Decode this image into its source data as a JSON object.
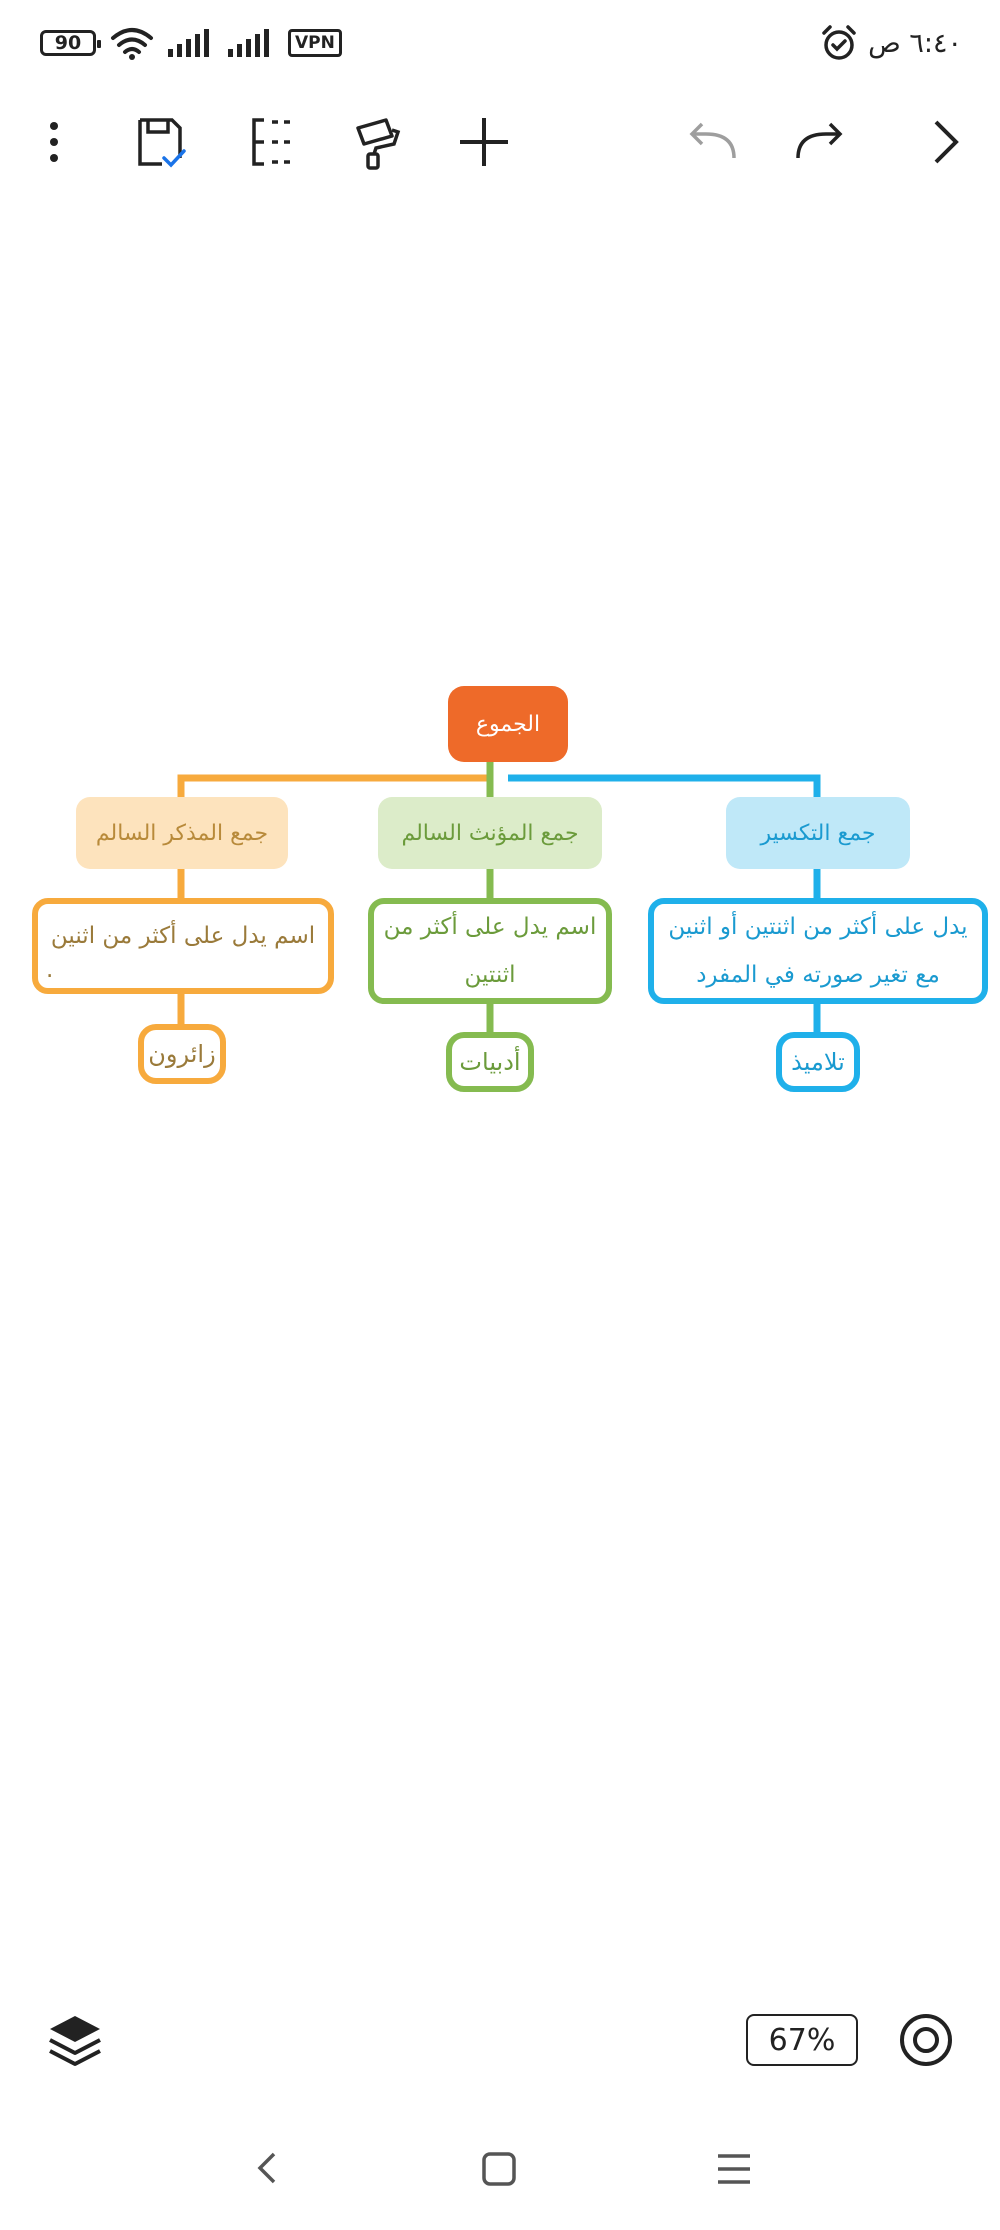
{
  "status_bar": {
    "battery": "90",
    "vpn": "VPN",
    "time": "٦:٤٠ ص"
  },
  "toolbar": {
    "icons": [
      "more-vertical-icon",
      "save-check-icon",
      "layout-icon",
      "format-painter-icon",
      "add-icon",
      "undo-icon",
      "redo-icon",
      "forward-icon"
    ]
  },
  "mindmap": {
    "root": "الجموع",
    "branches": [
      {
        "title": "جمع التكسير",
        "description_line1": "يدل على أكثر من اثنتين أو اثنين",
        "description_line2": "مع تغير صورته في المفرد",
        "example": "تلاميذ",
        "color": "#1fb0ea",
        "fill": "#bfe8f8",
        "text_color": "#1a9ad0"
      },
      {
        "title": "جمع المؤنث السالم",
        "description_line1": "اسم يدل على أكثر من",
        "description_line2": "اثنتين",
        "example": "أدبيات",
        "color": "#85bb50",
        "fill": "#dcecc9",
        "text_color": "#6b9b3b"
      },
      {
        "title": "جمع المذكر السالم",
        "description_line1": "اسم يدل على أكثر من اثنين",
        "description_line2": ".",
        "example": "زائرون",
        "color": "#f7aa3d",
        "fill": "#fde3bd",
        "text_color": "#b88a3a"
      }
    ]
  },
  "bottom": {
    "zoom": "67%",
    "icons": [
      "layers-icon",
      "center-target-icon"
    ]
  },
  "nav": {
    "icons": [
      "back-icon",
      "home-icon",
      "menu-icon"
    ]
  }
}
